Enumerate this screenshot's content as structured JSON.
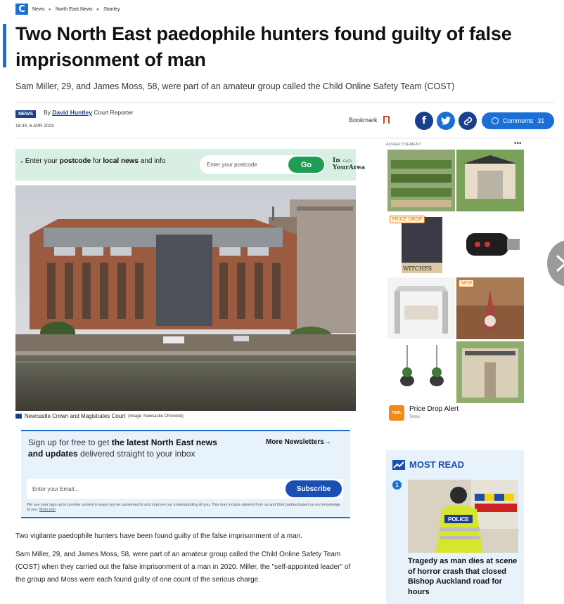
{
  "breadcrumb": {
    "logo": "C",
    "items": [
      "News",
      "North East News",
      "Stanley"
    ]
  },
  "article": {
    "headline": "Two North East paedophile hunters found guilty of false imprisonment of man",
    "standfirst": "Sam Miller, 29, and James Moss, 58, were part of an amateur group called the Child Online Safety Team (COST)",
    "badge": "NEWS",
    "by_prefix": "By",
    "author": "David Huntley",
    "author_role": "Court Reporter",
    "date": "18:30, 6 APR 2023",
    "bookmark_label": "Bookmark",
    "comments_label": "Comments",
    "comments_count": "31",
    "paragraphs": [
      "Two vigilante paedophile hunters have been found guilty of the false imprisonment of a man.",
      "Sam Miller, 29, and James Moss, 58, were part of an amateur group called the Child Online Safety Team (COST) when they carried out the false imprisonment of a man in 2020. Miller, the \"self-appointed leader\" of the group and Moss were each found guilty of one count of the serious charge."
    ]
  },
  "postcode": {
    "prefix": "Enter your ",
    "bold1": "postcode",
    "middle": " for ",
    "bold2": "local news",
    "suffix": " and info",
    "placeholder": "Enter your postcode",
    "button": "Go",
    "logo_line1": "In",
    "logo_line2": "YourArea"
  },
  "hero": {
    "caption": "Newcastle Crown and Magistrates Court",
    "credit": "(Image: Newcastle Chronicle)"
  },
  "newsletter": {
    "lead": "Sign up for free to get ",
    "bold": "the latest North East news and updates",
    "tail": " delivered straight to your inbox",
    "more": "More Newsletters",
    "placeholder": "Enter your Email...",
    "button": "Subscribe",
    "fine_print": "We use your sign-up to provide content in ways you've consented to and improve our understanding of you. This may include adverts from us and third parties based on our knowledge of you.",
    "more_info": "More info"
  },
  "ad": {
    "label": "ADVERTISEMENT",
    "tags": [
      "PRICE DROP",
      "NEW"
    ],
    "sign_text": "WITCHES",
    "brand_badge": "TEMU",
    "title": "Price Drop Alert",
    "sponsor": "Temu"
  },
  "most_read": {
    "heading": "MOST READ",
    "items": [
      {
        "rank": "1",
        "title": "Tragedy as man dies at scene of horror crash that closed Bishop Auckland road for hours",
        "sign": "POLICE"
      }
    ]
  },
  "colors": {
    "accent": "#1a6fd6",
    "navy": "#1a3f8f",
    "green": "#1f9d55"
  }
}
